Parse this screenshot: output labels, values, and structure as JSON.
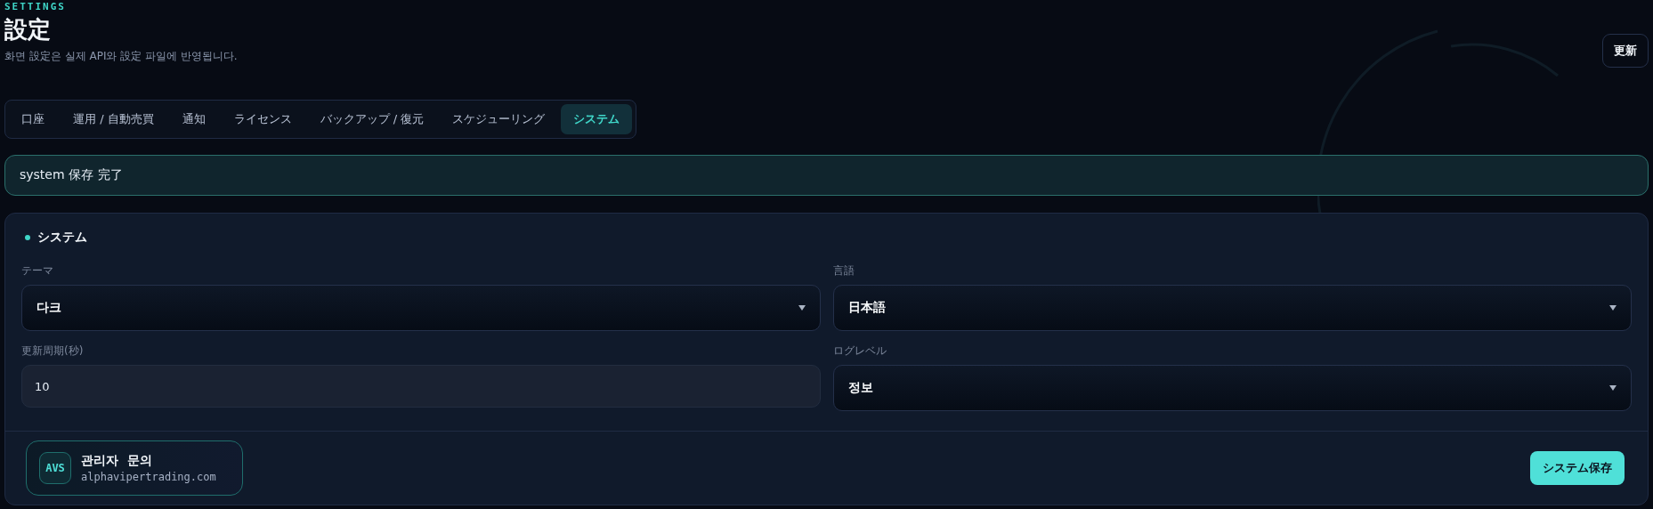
{
  "header": {
    "eyebrow": "SETTINGS",
    "title": "設定",
    "subtitle": "화면 設定은 실제 API와 設定 파일에 반영됩니다.",
    "refresh_button": "更新"
  },
  "tabs": [
    {
      "label": "口座",
      "selected": false
    },
    {
      "label": "運用 / 自動売買",
      "selected": false
    },
    {
      "label": "通知",
      "selected": false
    },
    {
      "label": "ライセンス",
      "selected": false
    },
    {
      "label": "バックアップ / 復元",
      "selected": false
    },
    {
      "label": "スケジューリング",
      "selected": false
    },
    {
      "label": "システム",
      "selected": true
    }
  ],
  "alert": {
    "message": "system 保存 完了"
  },
  "panel": {
    "title": "システム",
    "fields": [
      {
        "kind": "select",
        "label": "テーマ",
        "value": "다크"
      },
      {
        "kind": "select",
        "label": "言語",
        "value": "日本語"
      },
      {
        "kind": "input",
        "label": "更新周期(秒)",
        "value": "10"
      },
      {
        "kind": "select",
        "label": "ログレベル",
        "value": "정보"
      }
    ],
    "contact": {
      "badge": "AVS",
      "title": "관리자  문의",
      "domain": "alphavipertrading.com"
    },
    "save_button": "システム保存"
  }
}
